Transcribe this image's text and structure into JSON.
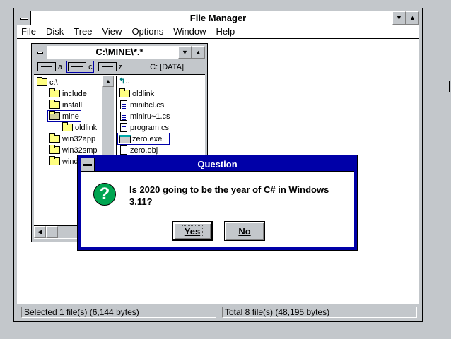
{
  "main": {
    "title": "File Manager",
    "menu": [
      "File",
      "Disk",
      "Tree",
      "View",
      "Options",
      "Window",
      "Help"
    ]
  },
  "child": {
    "title": "C:\\MINE\\*.*",
    "drives": [
      "a",
      "c",
      "z"
    ],
    "volume": "C: [DATA]",
    "tree": [
      "c:\\",
      "include",
      "install",
      "mine",
      "oldlink",
      "win32app",
      "win32smp",
      "windows"
    ],
    "files": [
      "..",
      "oldlink",
      "minibcl.cs",
      "miniru~1.cs",
      "program.cs",
      "zero.exe",
      "zero.obj"
    ]
  },
  "status": {
    "selected": "Selected 1 file(s) (6,144 bytes)",
    "total": "Total 8 file(s) (48,195 bytes)"
  },
  "dialog": {
    "title": "Question",
    "message": "Is 2020 going to be the year of C# in Windows 3.11?",
    "yes": "Yes",
    "no": "No",
    "icon": "question-icon",
    "icon_color": "#00a651"
  }
}
